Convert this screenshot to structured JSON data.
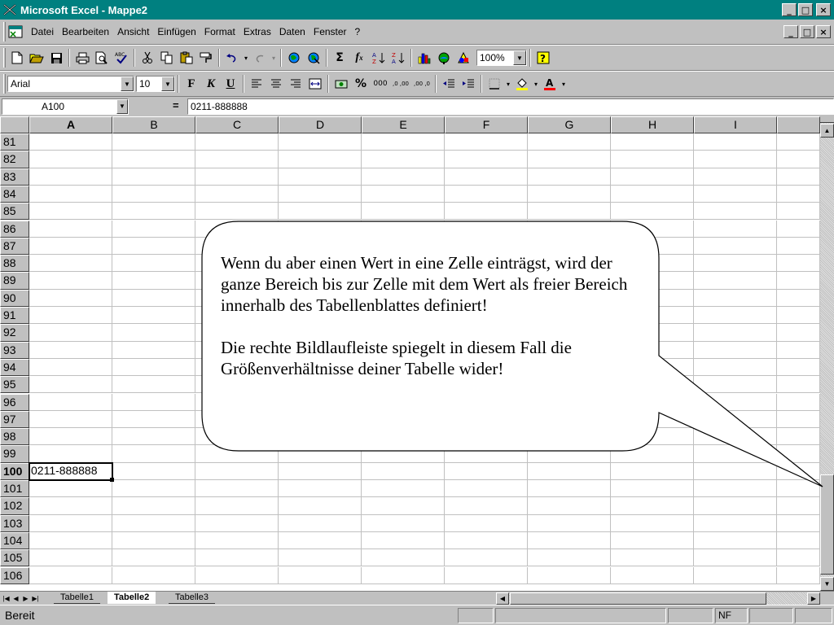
{
  "window": {
    "title": "Microsoft Excel - Mappe2",
    "minimize": "_",
    "maximize": "□",
    "close": "×"
  },
  "menu": {
    "items": [
      {
        "label": "Datei"
      },
      {
        "label": "Bearbeiten"
      },
      {
        "label": "Ansicht"
      },
      {
        "label": "Einfügen"
      },
      {
        "label": "Format"
      },
      {
        "label": "Extras"
      },
      {
        "label": "Daten"
      },
      {
        "label": "Fenster"
      },
      {
        "label": "?"
      }
    ]
  },
  "toolbar_standard": {
    "icons": [
      "new-icon",
      "open-icon",
      "save-icon",
      "print-icon",
      "print-preview-icon",
      "spellcheck-icon",
      "cut-icon",
      "copy-icon",
      "paste-icon",
      "format-painter-icon",
      "undo-icon",
      "redo-icon",
      "web-icon",
      "hyperlink-icon",
      "autosum-icon",
      "function-icon",
      "sort-ascending-icon",
      "sort-descending-icon",
      "chart-wizard-icon",
      "map-icon",
      "drawing-icon",
      "help-icon"
    ],
    "zoom": "100%"
  },
  "toolbar_format": {
    "font": "Arial",
    "font_size": "10",
    "bold": "F",
    "italic": "K",
    "underline": "U",
    "percent": "%",
    "thousands": "000",
    "increase_decimal": ",0 ,00",
    "decrease_decimal": ",00 ,0"
  },
  "formula_bar": {
    "name_box": "A100",
    "equals": "=",
    "content": "0211-888888"
  },
  "grid": {
    "columns": [
      "A",
      "B",
      "C",
      "D",
      "E",
      "F",
      "G",
      "H",
      "I"
    ],
    "active_column": "A",
    "rows": [
      "81",
      "82",
      "83",
      "84",
      "85",
      "86",
      "87",
      "88",
      "89",
      "90",
      "91",
      "92",
      "93",
      "94",
      "95",
      "96",
      "97",
      "98",
      "99",
      "100",
      "101",
      "102",
      "103",
      "104",
      "105",
      "106"
    ],
    "active_row": "100",
    "active_cell_value": "0211-888888"
  },
  "callout": {
    "paragraph1": "Wenn du aber einen Wert in eine Zelle einträgst, wird der ganze Bereich bis zur Zelle mit dem Wert als freier Bereich innerhalb des Tabellenblattes definiert!",
    "paragraph2": "Die rechte Bildlaufleiste spiegelt in diesem Fall die Größenverhältnisse deiner Tabelle wider!"
  },
  "sheets": {
    "tabs": [
      "Tabelle1",
      "Tabelle2",
      "Tabelle3"
    ],
    "active": "Tabelle2"
  },
  "status": {
    "text": "Bereit",
    "indicator": "NF"
  }
}
